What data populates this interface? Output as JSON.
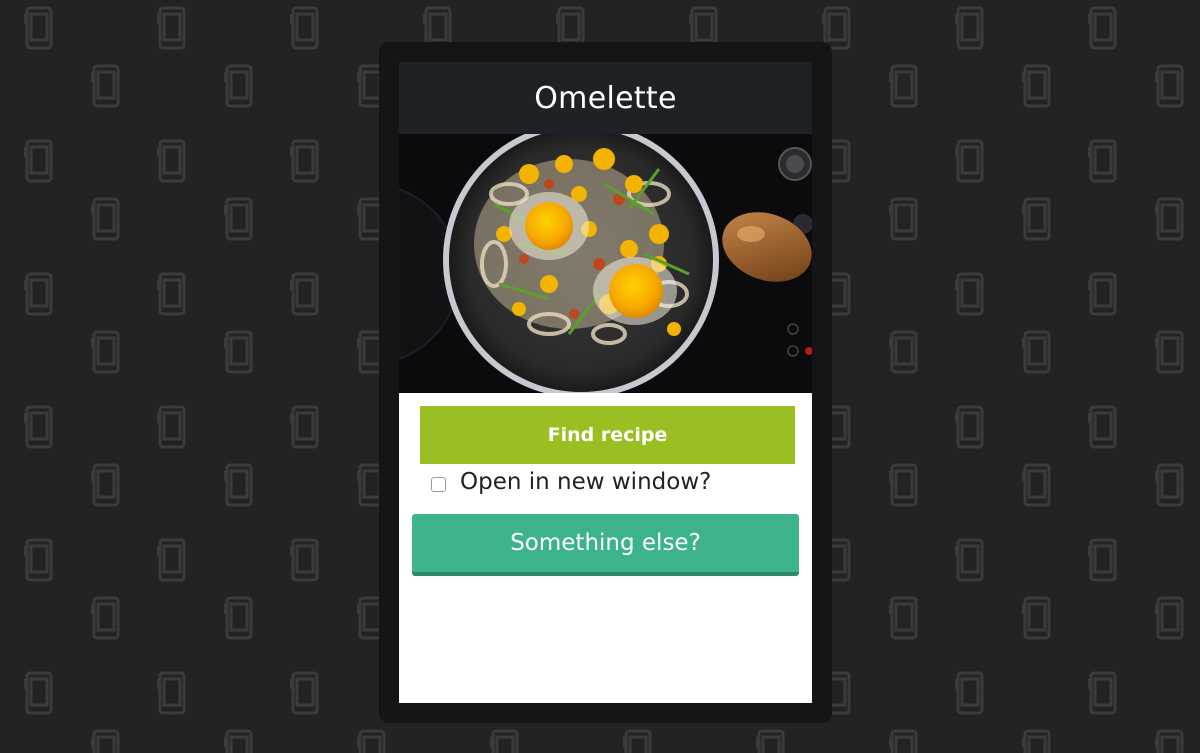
{
  "app": {
    "title": "Omelette"
  },
  "image": {
    "subject": "fried eggs with vegetables in a pan"
  },
  "actions": {
    "find_recipe_label": "Find recipe",
    "open_new_window_label": "Open in new window?",
    "open_new_window_checked": false,
    "something_else_label": "Something else?"
  },
  "colors": {
    "background": "#232323",
    "header": "#1e2227",
    "find_button": "#99bf22",
    "else_button": "#3db38a",
    "pattern_icon": "#3a3a3a"
  },
  "icons": {
    "background_pattern": "phone-icon"
  }
}
